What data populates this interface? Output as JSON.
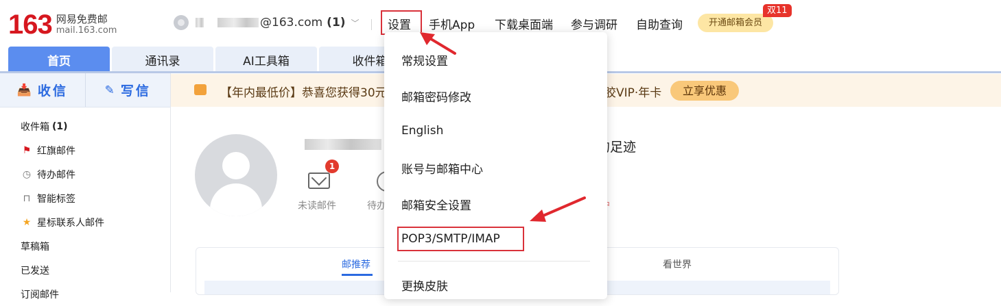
{
  "header": {
    "logo_number": "163",
    "logo_name": "网易免费邮",
    "logo_domain": "mail.163.com",
    "account_email": "@163.com",
    "account_unread": "(1)",
    "nav": [
      "设置",
      "手机App",
      "下载桌面端",
      "参与调研",
      "自助查询"
    ],
    "vip_button": "开通邮箱会员",
    "promo_badge": "双11"
  },
  "tabs": [
    "首页",
    "通讯录",
    "AI工具箱",
    "收件箱"
  ],
  "sidebar": {
    "receive": "收信",
    "compose": "写信",
    "folders": [
      {
        "label": "收件箱",
        "count": "(1)",
        "icon": "none"
      },
      {
        "label": "红旗邮件",
        "icon": "red-flag-icon"
      },
      {
        "label": "待办邮件",
        "icon": "clock-icon"
      },
      {
        "label": "智能标签",
        "icon": "bookmark-icon"
      },
      {
        "label": "星标联系人邮件",
        "icon": "star-icon"
      },
      {
        "label": "草稿箱",
        "icon": "none"
      },
      {
        "label": "已发送",
        "icon": "none"
      },
      {
        "label": "订阅邮件",
        "icon": "none"
      }
    ]
  },
  "banner": {
    "text_left": "【年内最低价】恭喜您获得30元",
    "text_right": "胶VIP·年卡",
    "button": "立享优惠"
  },
  "profile": {
    "footprint_text": "的足迹",
    "unread_label": "未读邮件",
    "unread_count": "1",
    "todo_label": "待办",
    "pink_text": "户"
  },
  "feed": {
    "tab_recommend": "邮推荐",
    "tab_world": "看世界"
  },
  "settings_menu": {
    "items": [
      "常规设置",
      "邮箱密码修改",
      "English",
      "账号与邮箱中心",
      "邮箱安全设置",
      "POP3/SMTP/IMAP",
      "更换皮肤"
    ]
  },
  "colors": {
    "brand_red": "#d6171f",
    "primary_blue": "#5b8def",
    "highlight_red": "#d9313a"
  }
}
